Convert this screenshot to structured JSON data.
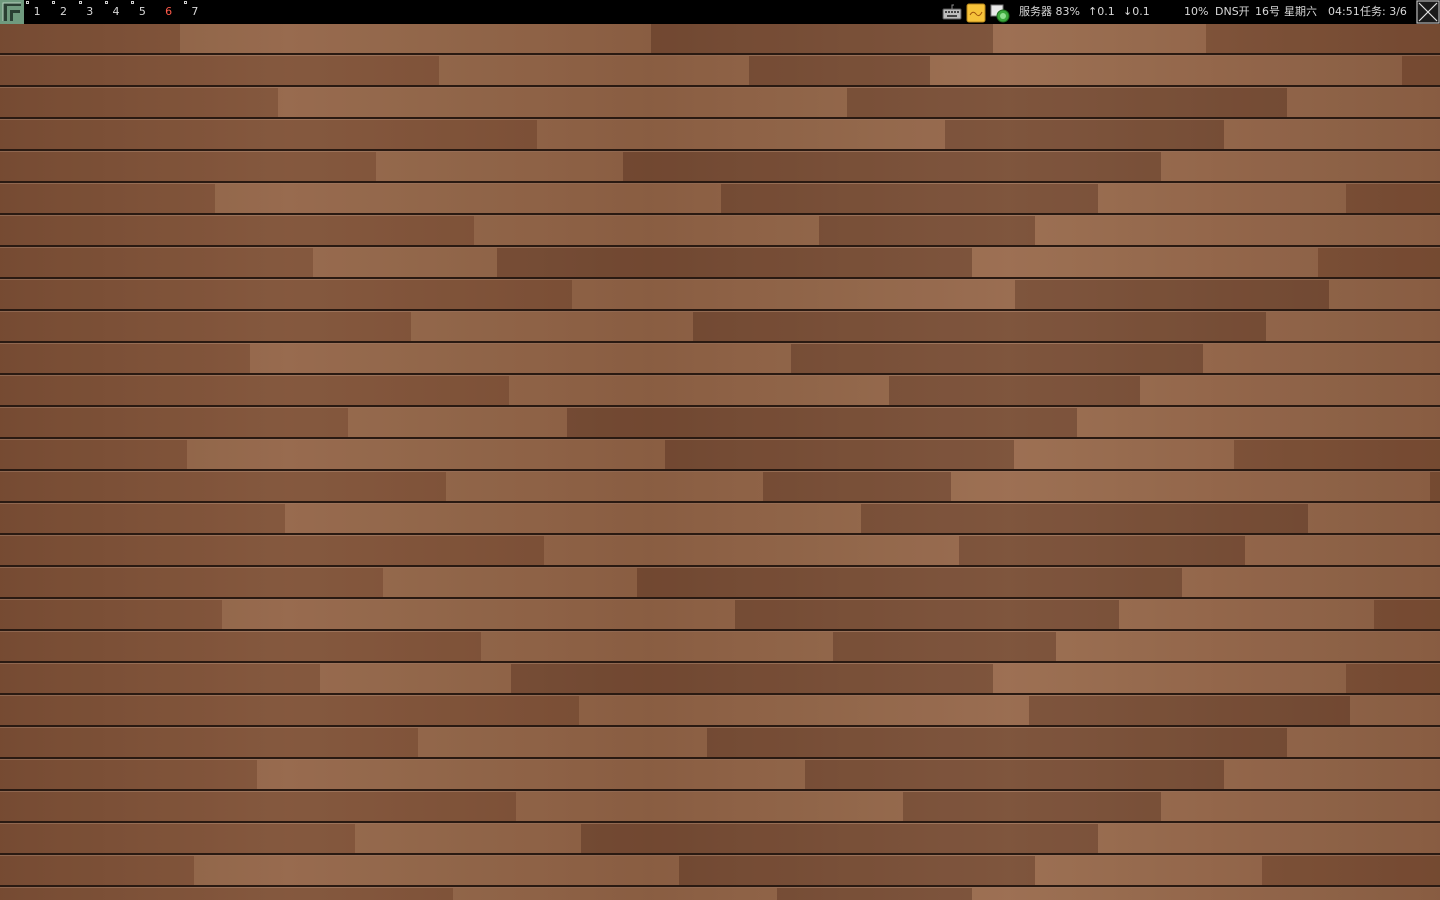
{
  "desktop": {
    "wallpaper": "wood-plank-wallpaper"
  },
  "panel": {
    "menu_icon": "app-menu-icon",
    "workspaces": [
      {
        "label": "1",
        "active": false,
        "occupied": true
      },
      {
        "label": "2",
        "active": false,
        "occupied": true
      },
      {
        "label": "3",
        "active": false,
        "occupied": true
      },
      {
        "label": "4",
        "active": false,
        "occupied": true
      },
      {
        "label": "5",
        "active": false,
        "occupied": true
      },
      {
        "label": "6",
        "active": true,
        "occupied": false
      },
      {
        "label": "7",
        "active": false,
        "occupied": true
      }
    ],
    "active_workspace_color": "#ff5a4a",
    "tray": {
      "keyboard_icon": "keyboard-icon",
      "notes_icon": "notes-icon",
      "network_icon": "network-status-icon",
      "server_label": "服务器 83%",
      "upload": "↑0.1",
      "download": "↓0.1",
      "cpu": "10%",
      "dns": "DNS开",
      "date": "16号",
      "weekday": "星期六",
      "time": "04:51",
      "tasks": "任务: 3/6"
    },
    "close_icon": "close-window-icon"
  }
}
